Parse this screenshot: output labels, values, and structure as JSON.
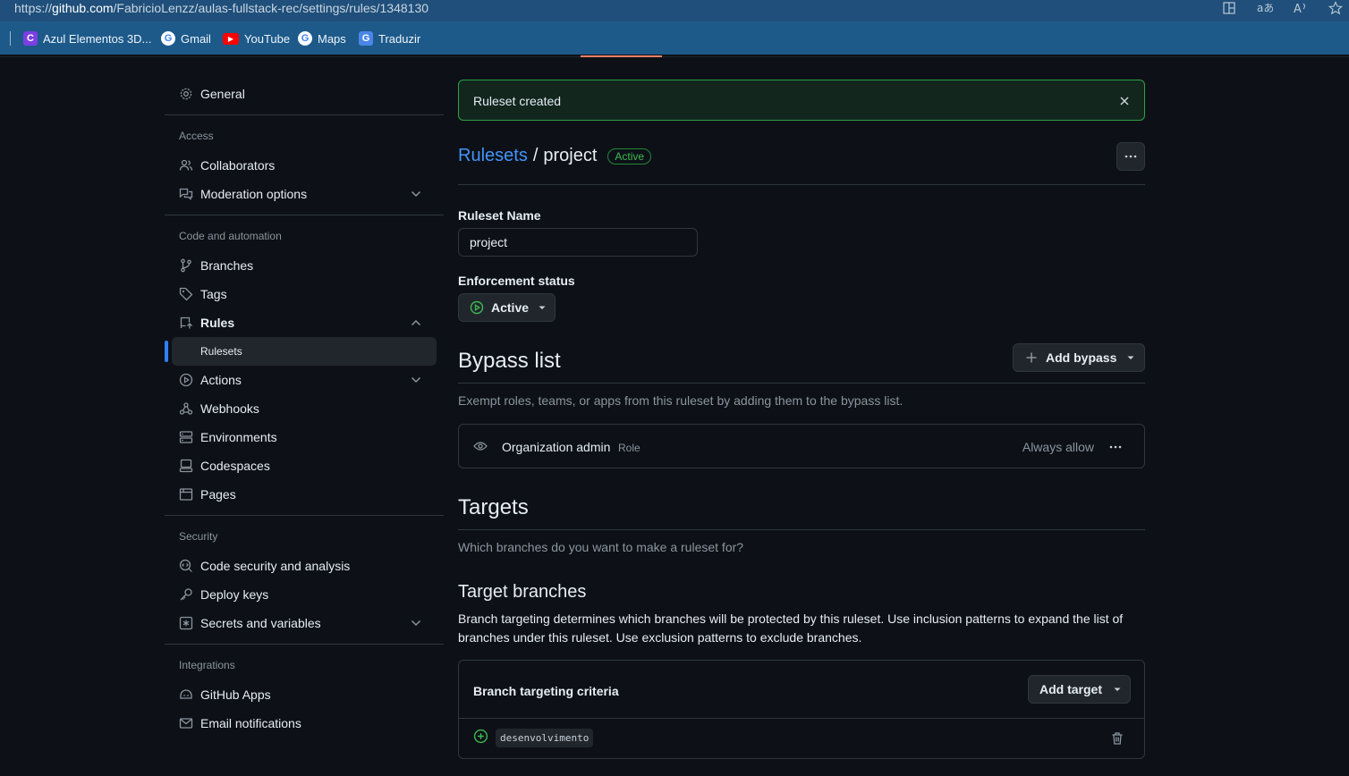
{
  "browser": {
    "url_prefix": "https://",
    "url_host": "github.com",
    "url_path": "/FabricioLenzz/aulas-fullstack-rec/settings/rules/1348130",
    "bookmarks": [
      {
        "label": "Azul Elementos 3D...",
        "icon": "canva-icon",
        "color": "#7b3fe4"
      },
      {
        "label": "Gmail",
        "icon": "google-icon",
        "color": "#4285f4"
      },
      {
        "label": "YouTube",
        "icon": "youtube-icon",
        "color": "#ff0000"
      },
      {
        "label": "Maps",
        "icon": "google-icon",
        "color": "#4285f4"
      },
      {
        "label": "Traduzir",
        "icon": "translate-icon",
        "color": "#4a86e8"
      }
    ]
  },
  "sidebar": {
    "general": "General",
    "access_heading": "Access",
    "collaborators": "Collaborators",
    "moderation": "Moderation options",
    "code_heading": "Code and automation",
    "branches": "Branches",
    "tags": "Tags",
    "rules": "Rules",
    "rulesets": "Rulesets",
    "actions": "Actions",
    "webhooks": "Webhooks",
    "environments": "Environments",
    "codespaces": "Codespaces",
    "pages": "Pages",
    "security_heading": "Security",
    "code_security": "Code security and analysis",
    "deploy_keys": "Deploy keys",
    "secrets": "Secrets and variables",
    "integrations_heading": "Integrations",
    "github_apps": "GitHub Apps",
    "email_notifications": "Email notifications"
  },
  "main": {
    "flash": "Ruleset created",
    "breadcrumb_link": "Rulesets",
    "breadcrumb_sep": "/",
    "ruleset_title": "project",
    "status_badge": "Active",
    "ruleset_name_label": "Ruleset Name",
    "ruleset_name_value": "project",
    "enforcement_label": "Enforcement status",
    "enforcement_value": "Active",
    "bypass_title": "Bypass list",
    "add_bypass": "Add bypass",
    "bypass_desc": "Exempt roles, teams, or apps from this ruleset by adding them to the bypass list.",
    "bypass_entry": {
      "name": "Organization admin",
      "type": "Role",
      "mode": "Always allow"
    },
    "targets_title": "Targets",
    "targets_desc": "Which branches do you want to make a ruleset for?",
    "target_branches_title": "Target branches",
    "target_branches_desc": "Branch targeting determines which branches will be protected by this ruleset. Use inclusion patterns to expand the list of branches under this ruleset. Use exclusion patterns to exclude branches.",
    "criteria_title": "Branch targeting criteria",
    "add_target": "Add target",
    "branch_pattern": "desenvolvimento"
  },
  "colors": {
    "accent": "#2f81f7",
    "success": "#3fb950",
    "flash_bg": "#12261e"
  }
}
